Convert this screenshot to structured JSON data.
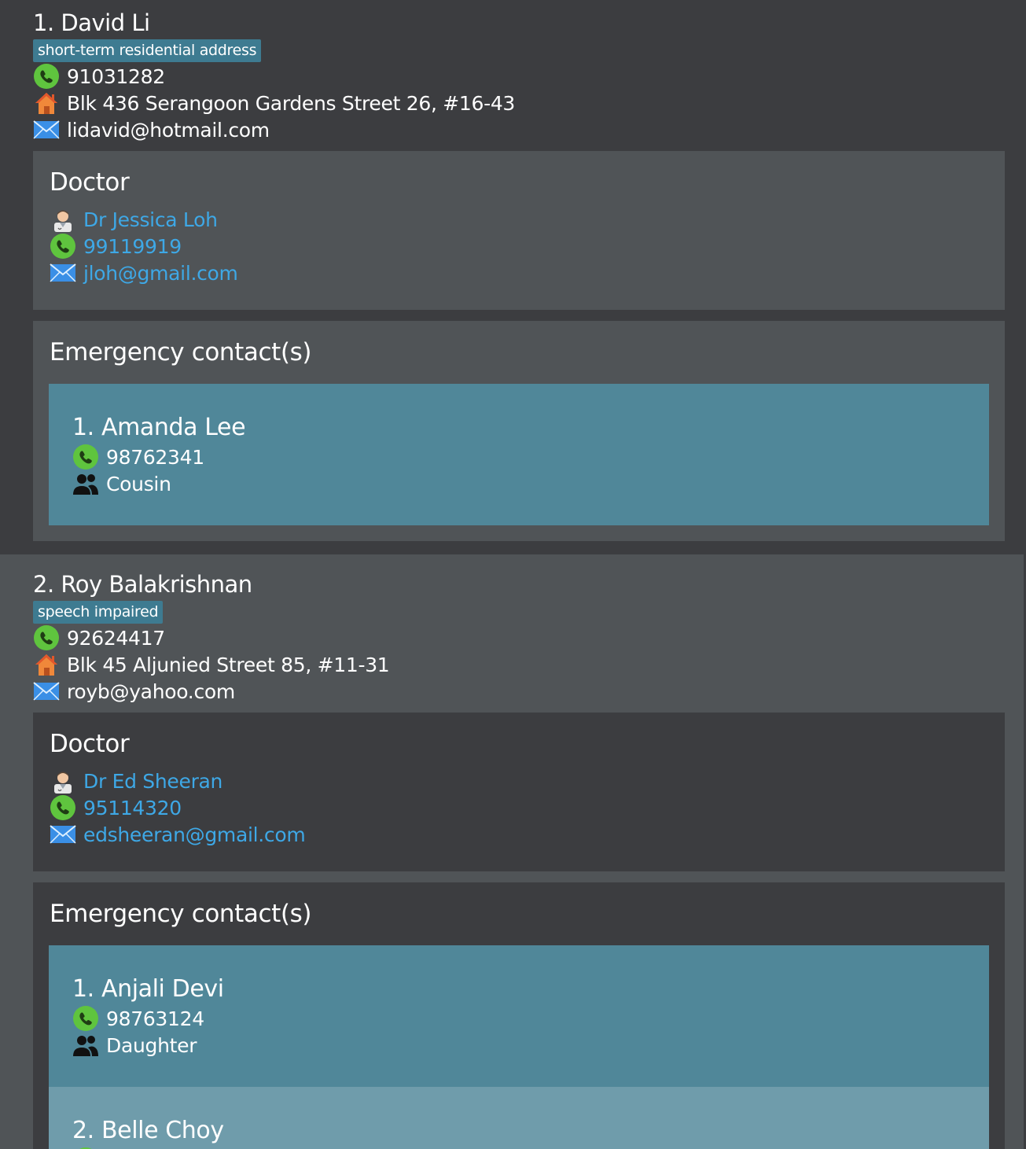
{
  "patients": [
    {
      "name": "1. David Li",
      "tag": "short-term residential address",
      "phone": "91031282",
      "address": "Blk 436 Serangoon Gardens Street 26, #16-43",
      "email": "lidavid@hotmail.com",
      "doctor_title": "Doctor",
      "doctor": {
        "name": "Dr Jessica Loh",
        "phone": "99119919",
        "email": "jloh@gmail.com"
      },
      "ec_title": "Emergency contact(s)",
      "contacts": [
        {
          "name": "1. Amanda Lee",
          "phone": "98762341",
          "relation": "Cousin"
        }
      ]
    },
    {
      "name": "2. Roy Balakrishnan",
      "tag": "speech impaired",
      "phone": "92624417",
      "address": "Blk 45 Aljunied Street 85, #11-31",
      "email": "royb@yahoo.com",
      "doctor_title": "Doctor",
      "doctor": {
        "name": "Dr Ed Sheeran",
        "phone": "95114320",
        "email": "edsheeran@gmail.com"
      },
      "ec_title": "Emergency contact(s)",
      "contacts": [
        {
          "name": "1. Anjali Devi",
          "phone": "98763124",
          "relation": "Daughter"
        },
        {
          "name": "2. Belle Choy"
        }
      ]
    }
  ],
  "colors": {
    "card_dark": "#3c3d40",
    "card_light": "#505457",
    "tag_bg": "#3e7b91",
    "link": "#3ea8e6",
    "contact_selected": "#508799",
    "contact_alt": "#6f9cab"
  },
  "icons": {
    "phone": "phone-icon",
    "home": "home-icon",
    "email": "mail-icon",
    "doctor": "doctor-icon",
    "relation": "people-icon"
  }
}
